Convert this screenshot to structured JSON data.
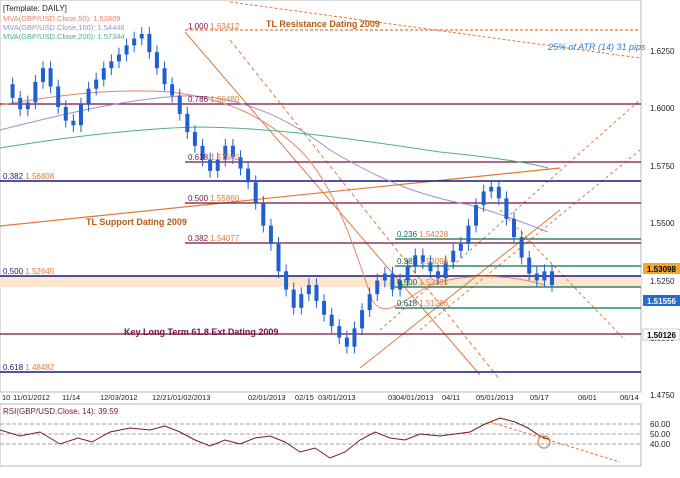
{
  "template_label": "[Template: DAILY]",
  "legend": [
    {
      "text": "MVA(GBP/USD.Close,50): 1.52809",
      "color": "#e4856a"
    },
    {
      "text": "MVA(GBP/USD.Close,100): 1.54446",
      "color": "#9b8fd3"
    },
    {
      "text": "MVA(GBP/USD.Close,200): 1.57344",
      "color": "#4fae8c"
    }
  ],
  "atr_note": "25% of ATR (14) 31 pips",
  "annotations": {
    "tl_resistance": "TL Resistance Dating 2009",
    "tl_support": "TL Support Dating 2009",
    "key_long_term": "Key Long Term 61.8 Ext Dating 2009"
  },
  "fib_labels": [
    {
      "ratio": "1.000",
      "value": "1.63412",
      "y": 1.6341
    },
    {
      "ratio": "0.786",
      "value": "1.60480",
      "y": 1.6045
    },
    {
      "ratio": "0.618",
      "value": "1.57642",
      "y": 1.5764
    },
    {
      "ratio": "0.500",
      "value": "1.55860",
      "y": 1.5587
    },
    {
      "ratio": "0.382",
      "value": "1.54077",
      "y": 1.5407
    },
    {
      "ratio": "0.236",
      "value": "1.54228",
      "y": 1.5423
    },
    {
      "ratio": "0.382",
      "value": "1.53096",
      "y": 1.531
    },
    {
      "ratio": "0.500",
      "value": "1.52181",
      "y": 1.5218
    },
    {
      "ratio": "0.618",
      "value": "1.51266",
      "y": 1.5127
    },
    {
      "ratio": "0.382",
      "value": "1.56808",
      "y": 1.5681
    },
    {
      "ratio": "0.500",
      "value": "1.52645",
      "y": 1.5265
    },
    {
      "ratio": "0.618",
      "value": "1.48482",
      "y": 1.4848
    }
  ],
  "price_flags": [
    {
      "value": "1.53098",
      "y": 1.531,
      "bg": "#f5a623",
      "fg": "#000000"
    },
    {
      "value": "1.51556",
      "y": 1.5156,
      "bg": "#1f6fd1",
      "fg": "#ffffff"
    },
    {
      "value": "1.50126",
      "y": 1.5013,
      "bg": "#ffffff",
      "fg": "#000000"
    }
  ],
  "yaxis_ticks": [
    "1.6250",
    "1.6000",
    "1.5750",
    "1.5500",
    "1.5250",
    "1.5000",
    "1.4750"
  ],
  "xaxis_ticks": [
    "10",
    "11/01/2012",
    "11/14",
    "12/03/2012",
    "12/21/01/02/2013",
    "02/01/2013",
    "02/15",
    "03/01/2013",
    "03",
    "04/01/2013",
    "04/11",
    "05/01/2013",
    "05/17",
    "06/01",
    "06/14"
  ],
  "rsi": {
    "label": "RSI(GBP/USD.Close, 14): 39.59",
    "ticks": [
      "60.00",
      "50.00",
      "40.00"
    ],
    "value": 39.59
  },
  "colors": {
    "candle": "#1f5fd0",
    "resistance_line": "#e07a3a",
    "fib_line": "#7a1040",
    "level_line": "#1a1a7a",
    "zone_fill": "#fde6cf",
    "rsi_line": "#7a1a1a"
  },
  "chart_data": {
    "type": "candlestick",
    "symbol": "GBP/USD",
    "timeframe": "DAILY",
    "ylim": [
      1.47,
      1.64
    ],
    "x": [
      "10",
      "11/01/2012",
      "11/14",
      "12/03/2012",
      "12/21",
      "01/02/2013",
      "02/01/2013",
      "02/15",
      "03/01/2013",
      "04/01/2013",
      "04/11",
      "05/01/2013",
      "05/17",
      "06/01",
      "06/14"
    ],
    "close_series": [
      1.604,
      1.598,
      1.593,
      1.596,
      1.605,
      1.611,
      1.603,
      1.594,
      1.588,
      1.586,
      1.595,
      1.602,
      1.606,
      1.611,
      1.614,
      1.617,
      1.621,
      1.624,
      1.626,
      1.618,
      1.611,
      1.604,
      1.599,
      1.591,
      1.583,
      1.577,
      1.571,
      1.566,
      1.571,
      1.577,
      1.572,
      1.567,
      1.561,
      1.552,
      1.542,
      1.534,
      1.522,
      1.514,
      1.506,
      1.512,
      1.516,
      1.509,
      1.503,
      1.498,
      1.493,
      1.489,
      1.497,
      1.505,
      1.512,
      1.518,
      1.521,
      1.514,
      1.518,
      1.524,
      1.529,
      1.526,
      1.522,
      1.519,
      1.526,
      1.531,
      1.534,
      1.542,
      1.551,
      1.557,
      1.559,
      1.554,
      1.545,
      1.537,
      1.528,
      1.521,
      1.518,
      1.522,
      1.516
    ]
  }
}
